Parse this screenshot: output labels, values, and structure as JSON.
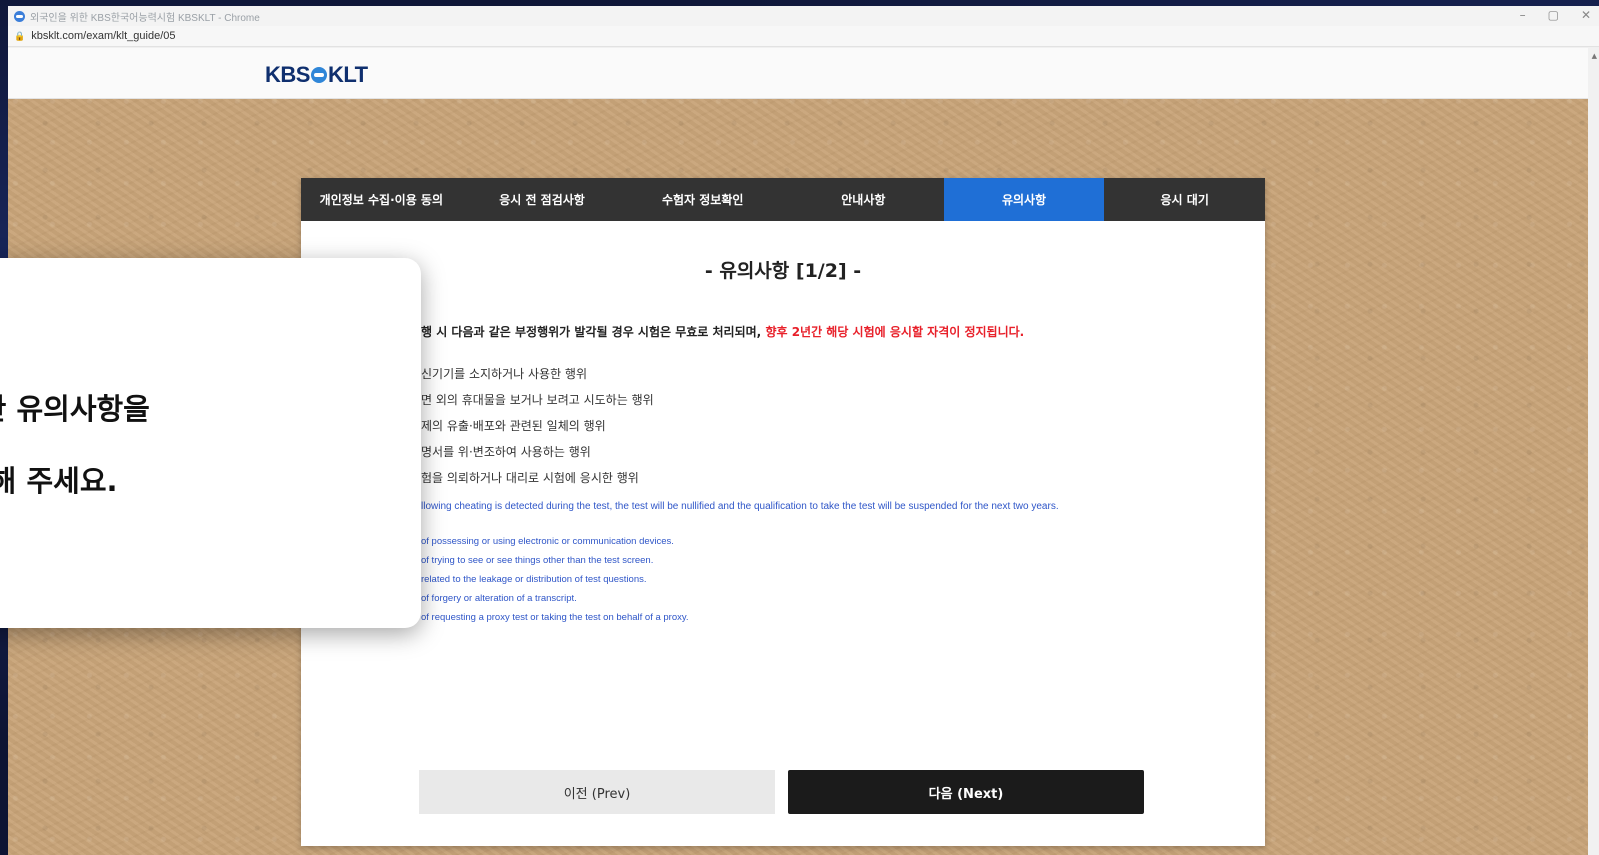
{
  "browser": {
    "title": "외국인을 위한 KBS한국어능력시험 KBSKLT - Chrome",
    "url": "kbsklt.com/exam/klt_guide/05",
    "controls": [
      "–",
      "▢",
      "✕"
    ]
  },
  "site": {
    "logo_left": "KBS",
    "logo_right": "KLT"
  },
  "tabs": [
    {
      "label": "개인정보 수집·이용 동의",
      "active": false
    },
    {
      "label": "응시 전 점검사항",
      "active": false
    },
    {
      "label": "수험자 정보확인",
      "active": false
    },
    {
      "label": "안내사항",
      "active": false
    },
    {
      "label": "유의사항",
      "active": true
    },
    {
      "label": "응시 대기",
      "active": false
    }
  ],
  "content": {
    "title": "- 유의사항 [1/2] -",
    "notice_ko": "행 시 다음과 같은 부정행위가 발각될 경우 시험은 무효로 처리되며,",
    "notice_ko_red": "향후 2년간 해당 시험에 응시할 자격이 정지됩니다.",
    "items_ko": [
      "신기기를 소지하거나 사용한 행위",
      "면 외의 휴대물을 보거나 보려고 시도하는 행위",
      "제의 유출·배포와 관련된 일체의 행위",
      "명서를 위·변조하여 사용하는 행위",
      "험을 의뢰하거나 대리로 시험에 응시한 행위"
    ],
    "notice_en": "llowing cheating is detected during the test, the test will be nullified and the qualification to take the test will be suspended for the next two years.",
    "items_en": [
      "of possessing or using electronic or communication devices.",
      "of trying to see or see things other than the test screen.",
      "related to the leakage or distribution of test questions.",
      "of forgery or alteration of a transcript.",
      "of requesting a proxy test or taking the test on behalf of a proxy."
    ]
  },
  "buttons": {
    "prev": "이전 (Prev)",
    "next": "다음 (Next)"
  },
  "overlay": {
    "line1": "관한 유의사항을",
    "line2": "인해 주세요."
  },
  "colors": {
    "active_tab": "#1f6fd6",
    "warning_red": "#e8202a",
    "english_blue": "#2f56c8",
    "tab_bar": "#333333",
    "next_button": "#1b1b1b"
  }
}
